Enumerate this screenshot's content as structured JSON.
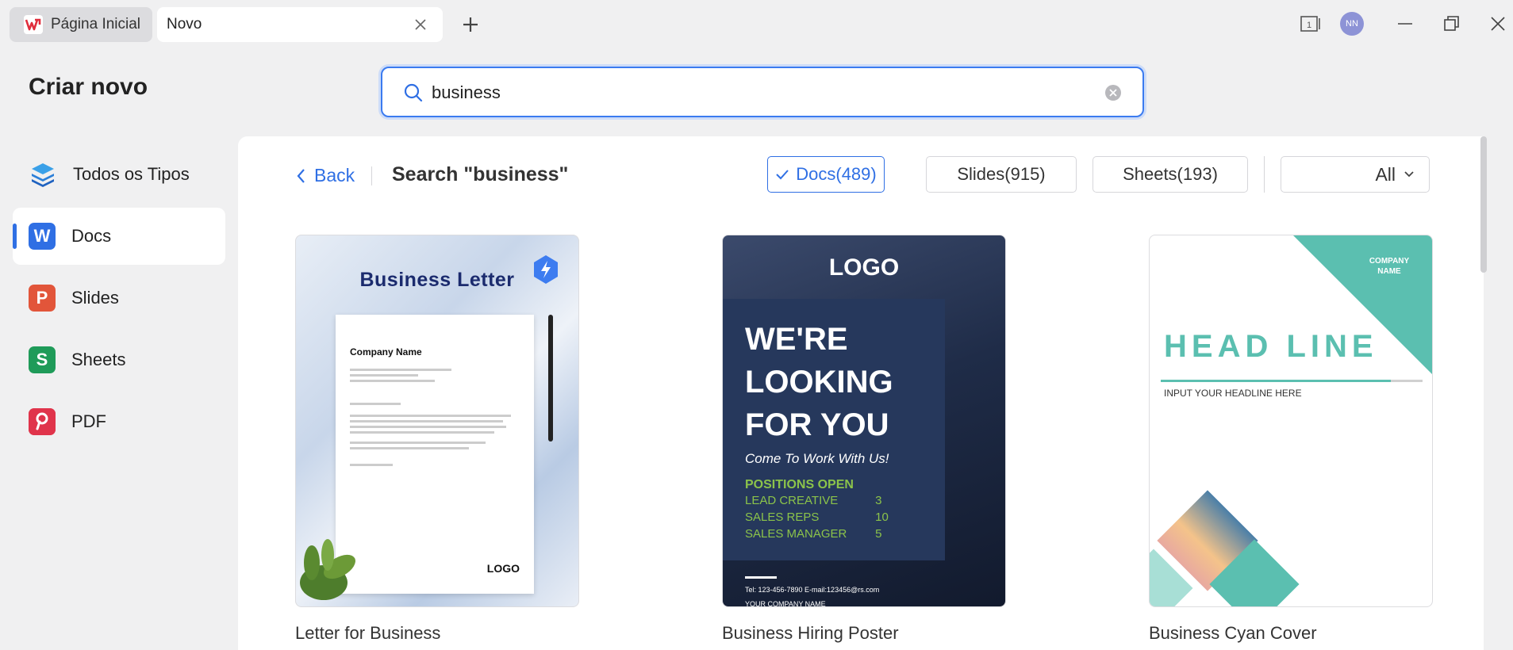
{
  "tabs": {
    "home_label": "Página Inicial",
    "new_label": "Novo"
  },
  "window": {
    "avatar_initials": "NN",
    "page_count": "1"
  },
  "page": {
    "title": "Criar novo"
  },
  "search": {
    "value": "business"
  },
  "sidebar": {
    "items": [
      {
        "label": "Todos os Tipos",
        "icon": "layers-icon"
      },
      {
        "label": "Docs",
        "icon": "docs-icon",
        "letter": "W"
      },
      {
        "label": "Slides",
        "icon": "slides-icon",
        "letter": "P"
      },
      {
        "label": "Sheets",
        "icon": "sheets-icon",
        "letter": "S"
      },
      {
        "label": "PDF",
        "icon": "pdf-icon"
      }
    ],
    "active": "Docs"
  },
  "results": {
    "back_label": "Back",
    "heading": "Search \"business\"",
    "filters": [
      {
        "label": "Docs(489)",
        "active": true
      },
      {
        "label": "Slides(915)",
        "active": false
      },
      {
        "label": "Sheets(193)",
        "active": false
      }
    ],
    "dropdown_value": "All"
  },
  "templates": [
    {
      "title": "Letter for Business",
      "preview": {
        "heading": "Business Letter",
        "company": "Company Name",
        "logo": "LOGO"
      }
    },
    {
      "title": "Business Hiring Poster",
      "preview": {
        "logo": "LOGO",
        "headline": [
          "WE'RE",
          "LOOKING",
          "FOR YOU"
        ],
        "tagline": "Come To Work With Us!",
        "positions_title": "POSITIONS OPEN",
        "positions": [
          {
            "role": "LEAD CREATIVE",
            "count": "3"
          },
          {
            "role": "SALES REPS",
            "count": "10"
          },
          {
            "role": "SALES MANAGER",
            "count": "5"
          }
        ],
        "contact": "Tel: 123-456-7890      E-mail:123456@rs.com",
        "company": "YOUR COMPANY NAME"
      }
    },
    {
      "title": "Business Cyan Cover",
      "preview": {
        "company": "COMPANY NAME",
        "headline": "HEAD LINE",
        "subline": "INPUT YOUR HEADLINE HERE"
      }
    }
  ],
  "colors": {
    "accent": "#2f6fe4",
    "docs": "#2f6fe4",
    "slides": "#e2553a",
    "sheets": "#1f9b59",
    "pdf": "#e0344b",
    "cyan": "#5bbfb0"
  }
}
